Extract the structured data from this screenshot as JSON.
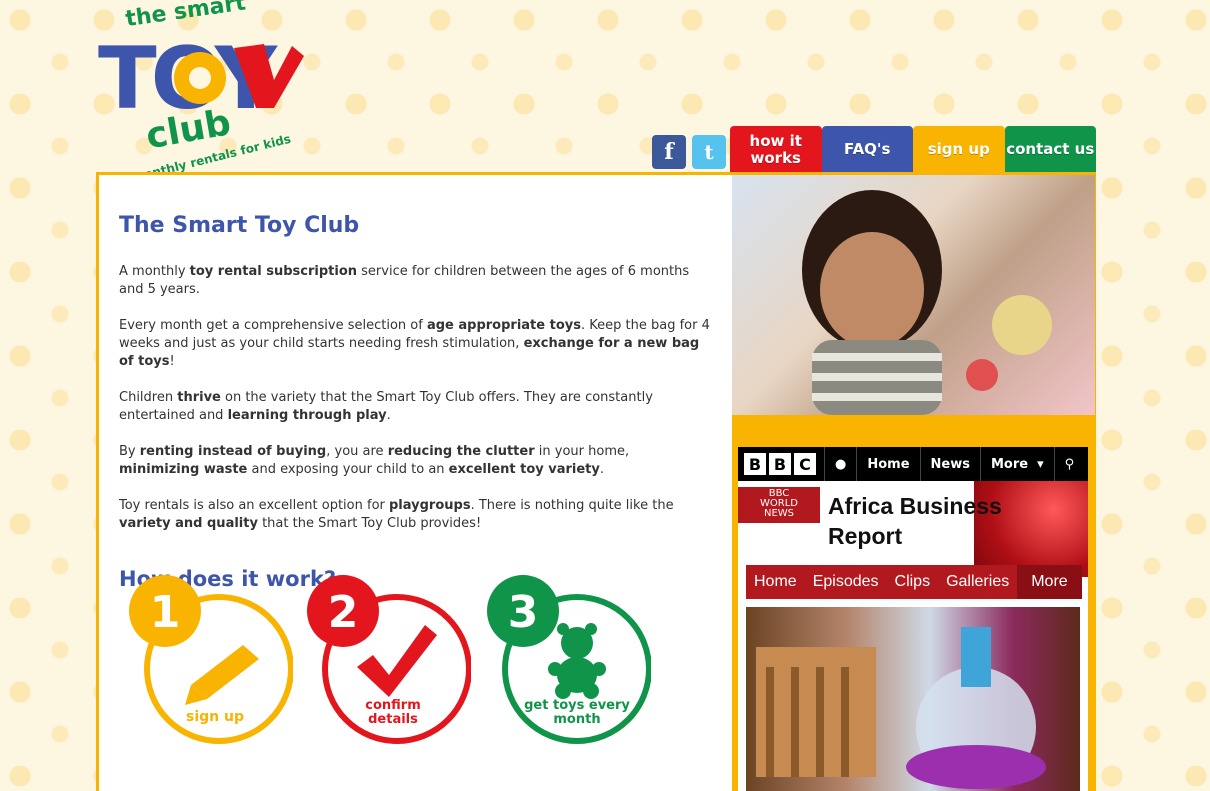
{
  "logo": {
    "top": "the smart",
    "main": "TOY",
    "club": "club",
    "tagline": "monthly rentals for kids"
  },
  "social": {
    "facebook_icon": "facebook-icon",
    "twitter_icon": "twitter-icon"
  },
  "nav": {
    "tabs": [
      {
        "label": "how it works",
        "color": "#e4161d"
      },
      {
        "label": "FAQ's",
        "color": "#3d56ab"
      },
      {
        "label": "sign up",
        "color": "#f8b400"
      },
      {
        "label": "contact us",
        "color": "#10944a"
      }
    ]
  },
  "main": {
    "title": "The Smart Toy Club",
    "p1": [
      "A monthly ",
      "toy rental subscription",
      " service for children between the ages of 6 months and 5 years."
    ],
    "p2": [
      "Every month get a comprehensive selection of ",
      "age appropriate toys",
      ". Keep the bag for 4 weeks and just as your child starts needing fresh stimulation, ",
      "exchange for a new bag of toys",
      "!"
    ],
    "p3": [
      "Children ",
      "thrive",
      " on the variety that the Smart Toy Club offers. They are constantly entertained and ",
      "learning through play",
      "."
    ],
    "p4": [
      "By ",
      "renting instead of buying",
      ", you are ",
      "reducing the clutter",
      " in your home, ",
      "minimizing waste",
      " and exposing your child to an ",
      "excellent toy variety",
      "."
    ],
    "p5": [
      "Toy rentals is also an excellent option for ",
      "playgroups",
      ". There is nothing quite like the ",
      "variety and quality",
      " that the Smart Toy Club provides!"
    ],
    "how_title": "How does it work?",
    "steps": [
      {
        "num": "1",
        "label": "sign up",
        "color": "#f8b400",
        "icon": "pencil-icon"
      },
      {
        "num": "2",
        "label": "confirm details",
        "color": "#e4161d",
        "icon": "checkmark-icon"
      },
      {
        "num": "3",
        "label": "get toys every month",
        "color": "#10944a",
        "icon": "teddy-bear-icon"
      }
    ]
  },
  "bbc": {
    "logo": [
      "B",
      "B",
      "C"
    ],
    "nav": [
      "Home",
      "News",
      "More"
    ],
    "world_news": [
      "BBC",
      "WORLD",
      "NEWS"
    ],
    "title_line1": "Africa Business",
    "title_line2": "Report",
    "subnav": [
      "Home",
      "Episodes",
      "Clips",
      "Galleries",
      "More"
    ]
  }
}
